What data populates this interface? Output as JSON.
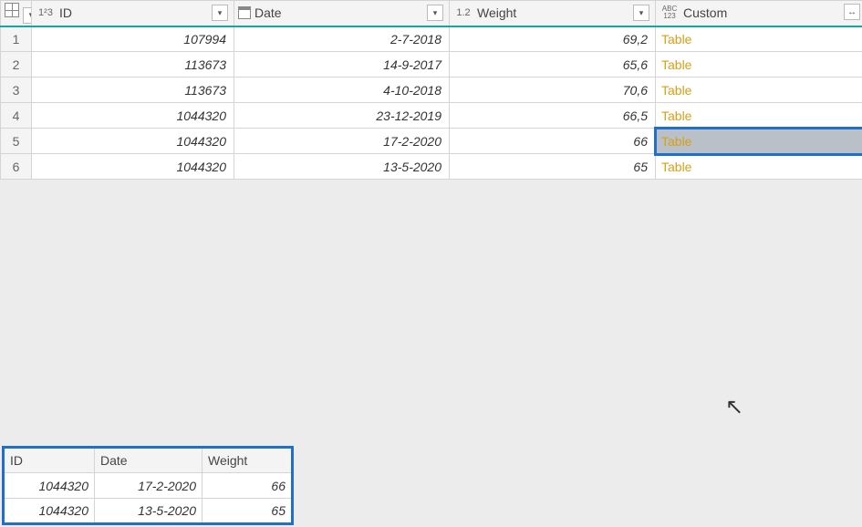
{
  "columns": {
    "id": {
      "label": "ID",
      "type_icon": "1²3"
    },
    "date": {
      "label": "Date",
      "type_icon": "cal"
    },
    "weight": {
      "label": "Weight",
      "type_icon": "1.2"
    },
    "custom": {
      "label": "Custom",
      "type_icon": "ABC123"
    }
  },
  "rows": [
    {
      "n": "1",
      "id": "107994",
      "date": "2-7-2018",
      "weight": "69,2",
      "custom": "Table",
      "selected": false
    },
    {
      "n": "2",
      "id": "113673",
      "date": "14-9-2017",
      "weight": "65,6",
      "custom": "Table",
      "selected": false
    },
    {
      "n": "3",
      "id": "113673",
      "date": "4-10-2018",
      "weight": "70,6",
      "custom": "Table",
      "selected": false
    },
    {
      "n": "4",
      "id": "1044320",
      "date": "23-12-2019",
      "weight": "66,5",
      "custom": "Table",
      "selected": false
    },
    {
      "n": "5",
      "id": "1044320",
      "date": "17-2-2020",
      "weight": "66",
      "custom": "Table",
      "selected": true
    },
    {
      "n": "6",
      "id": "1044320",
      "date": "13-5-2020",
      "weight": "65",
      "custom": "Table",
      "selected": false
    }
  ],
  "preview": {
    "headers": {
      "id": "ID",
      "date": "Date",
      "weight": "Weight"
    },
    "rows": [
      {
        "id": "1044320",
        "date": "17-2-2020",
        "weight": "66"
      },
      {
        "id": "1044320",
        "date": "13-5-2020",
        "weight": "65"
      }
    ]
  }
}
